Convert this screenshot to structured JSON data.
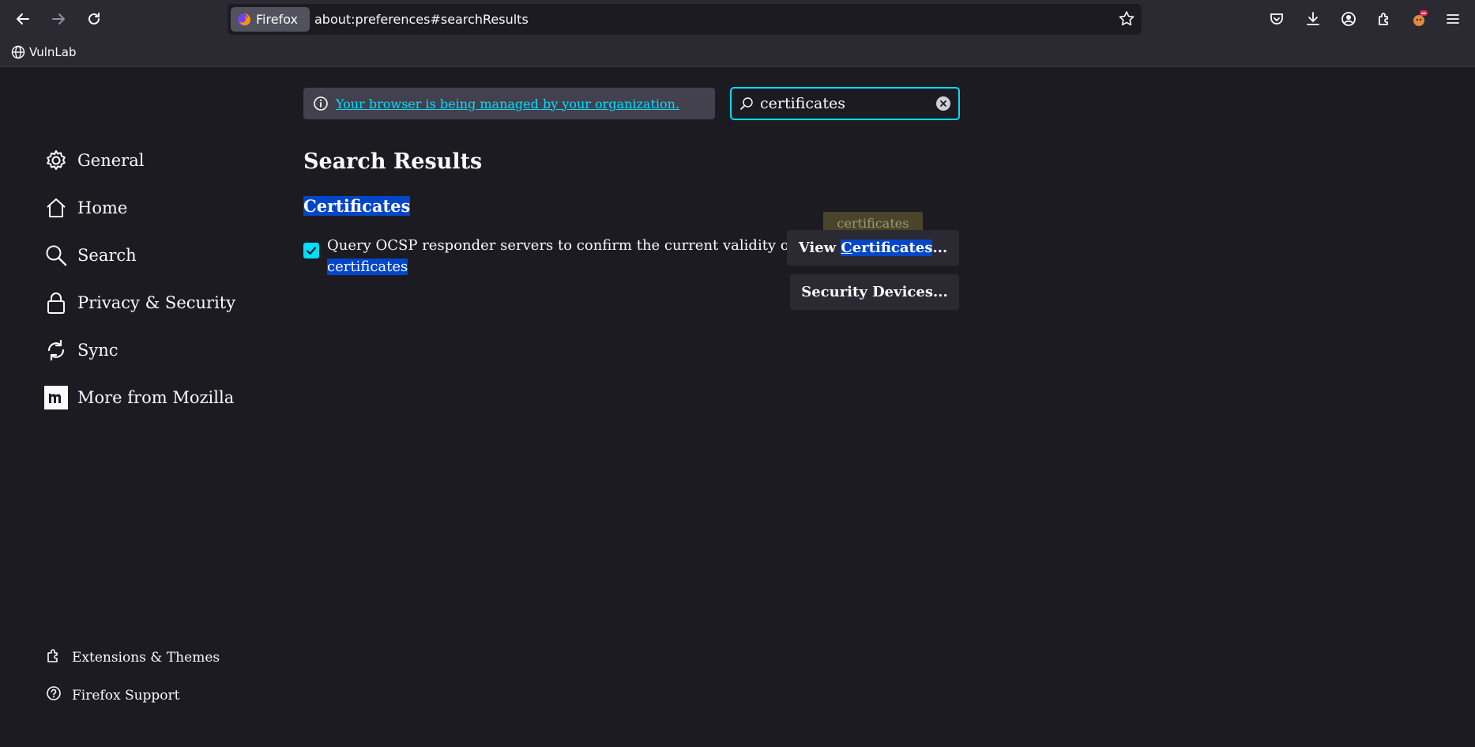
{
  "browser": {
    "identity_label": "Firefox",
    "url": "about:preferences#searchResults",
    "bookmark": "VulnLab"
  },
  "policy": {
    "text": "Your browser is being managed by your organization."
  },
  "search": {
    "value": "certificates"
  },
  "sidebar": {
    "items": [
      {
        "label": "General",
        "icon": "gear-icon"
      },
      {
        "label": "Home",
        "icon": "home-icon"
      },
      {
        "label": "Search",
        "icon": "search-icon"
      },
      {
        "label": "Privacy & Security",
        "icon": "lock-icon"
      },
      {
        "label": "Sync",
        "icon": "sync-icon"
      },
      {
        "label": "More from Mozilla",
        "icon": "mozilla-icon"
      }
    ],
    "footer": [
      {
        "label": "Extensions & Themes",
        "icon": "extensions-icon"
      },
      {
        "label": "Firefox Support",
        "icon": "help-icon"
      }
    ]
  },
  "main": {
    "title": "Search Results",
    "section": "Certificates",
    "pref_text": "Query OCSP responder servers to confirm the current validity of",
    "pref_highlight": "certificates",
    "pref_checked": true,
    "view_btn_prefix": "View ",
    "view_btn_c": "C",
    "view_btn_rest": "ertificates",
    "view_btn_suffix": "...",
    "security_btn": "Security Devices...",
    "tooltip": "certificates"
  },
  "colors": {
    "accent": "#00ddff",
    "highlight": "#0046c8",
    "background": "#1c1b22"
  }
}
